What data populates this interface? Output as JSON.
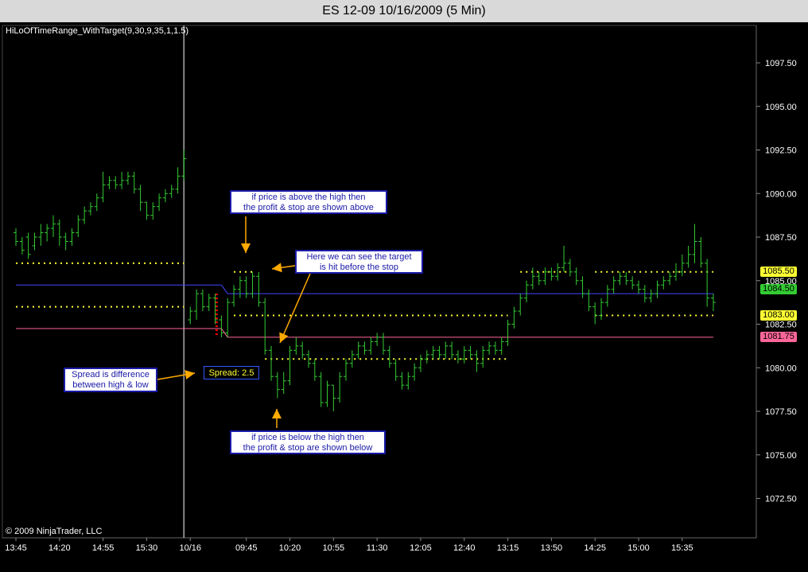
{
  "window": {
    "title": "ES 12-09  10/16/2009 (5 Min)"
  },
  "indicator_label": "HiLoOfTimeRange_WithTarget(9,30,9,35,1,1.5)",
  "copyright": "© 2009 NinjaTrader, LLC",
  "annotations": {
    "top_callout": [
      "if price is above the high then",
      "the profit & stop are shown above"
    ],
    "target_callout": [
      "Here we can see the target",
      "is hit before the stop"
    ],
    "spread_callout": [
      "Spread is difference",
      "between high & low"
    ],
    "bottom_callout": [
      "if price is below the high then",
      "the profit & stop are shown below"
    ],
    "spread_label": "Spread: 2.5"
  },
  "price_tags": [
    {
      "label": "1085.50",
      "value": 1085.5,
      "color": "#ffff33"
    },
    {
      "label": "1084.50",
      "value": 1084.5,
      "color": "#33cc33"
    },
    {
      "label": "1083.00",
      "value": 1083.0,
      "color": "#ffff33"
    },
    {
      "label": "1081.75",
      "value": 1081.75,
      "color": "#ff6699"
    }
  ],
  "colors": {
    "bars": "#33cc33",
    "target_dots": "#ffff33",
    "high_line": "#4444ff",
    "low_line": "#ff6699",
    "session_divider": "#ffffff",
    "spread_marker": "#ff0000",
    "arrow": "#ffaa00"
  },
  "chart_data": {
    "type": "ohlc",
    "title": "ES 12-09  10/16/2009 (5 Min)",
    "xlabel": "",
    "ylabel": "",
    "ylim": [
      1070.5,
      1099.5
    ],
    "y_ticks": [
      "1097.50",
      "1095.00",
      "1092.50",
      "1090.00",
      "1087.50",
      "1085.00",
      "1082.50",
      "1080.00",
      "1077.50",
      "1075.00",
      "1072.50"
    ],
    "x_ticks": [
      "13:45",
      "14:20",
      "14:55",
      "15:30",
      "10/16",
      "09:45",
      "10:20",
      "10:55",
      "11:30",
      "12:05",
      "12:40",
      "13:15",
      "13:50",
      "14:25",
      "15:00",
      "15:35"
    ],
    "x_tick_index": [
      0,
      7,
      14,
      21,
      28,
      37,
      44,
      51,
      58,
      65,
      72,
      79,
      86,
      93,
      100,
      107
    ],
    "session_break_index": 28.5,
    "bars": [
      [
        1087.75,
        1087.25
      ],
      [
        1087.25,
        1086.75
      ],
      [
        1087.5,
        1086.5
      ],
      [
        1087.0,
        1087.5
      ],
      [
        1087.5,
        1087.75
      ],
      [
        1087.75,
        1088.0
      ],
      [
        1088.0,
        1088.25
      ],
      [
        1088.25,
        1087.5
      ],
      [
        1087.5,
        1087.25
      ],
      [
        1087.25,
        1087.75
      ],
      [
        1087.75,
        1088.5
      ],
      [
        1088.5,
        1089.0
      ],
      [
        1089.0,
        1089.25
      ],
      [
        1089.25,
        1089.75
      ],
      [
        1089.75,
        1090.5
      ],
      [
        1090.5,
        1090.75
      ],
      [
        1090.75,
        1090.5
      ],
      [
        1090.5,
        1090.75
      ],
      [
        1090.75,
        1091.0
      ],
      [
        1091.0,
        1090.25
      ],
      [
        1090.25,
        1089.5
      ],
      [
        1089.5,
        1088.75
      ],
      [
        1088.75,
        1089.25
      ],
      [
        1089.25,
        1089.75
      ],
      [
        1089.75,
        1090.0
      ],
      [
        1090.0,
        1090.25
      ],
      [
        1090.25,
        1091.0
      ],
      [
        1091.0,
        1092.0
      ],
      [
        1082.75,
        1083.25
      ],
      [
        1083.25,
        1084.25
      ],
      [
        1084.25,
        1083.5
      ],
      [
        1083.5,
        1084.0
      ],
      [
        1084.0,
        1082.75
      ],
      [
        1082.75,
        1082.0
      ],
      [
        1082.0,
        1083.75
      ],
      [
        1083.75,
        1084.5
      ],
      [
        1084.5,
        1085.0
      ],
      [
        1085.0,
        1084.25
      ],
      [
        1084.25,
        1085.25
      ],
      [
        1085.25,
        1083.75
      ],
      [
        1083.75,
        1081.0
      ],
      [
        1081.0,
        1079.5
      ],
      [
        1079.5,
        1078.75
      ],
      [
        1078.75,
        1079.25
      ],
      [
        1079.25,
        1081.0
      ],
      [
        1081.0,
        1081.25
      ],
      [
        1081.25,
        1080.75
      ],
      [
        1080.75,
        1080.25
      ],
      [
        1080.25,
        1079.5
      ],
      [
        1079.5,
        1078.0
      ],
      [
        1078.0,
        1079.0
      ],
      [
        1079.0,
        1078.25
      ],
      [
        1078.25,
        1079.5
      ],
      [
        1079.5,
        1080.25
      ],
      [
        1080.25,
        1080.75
      ],
      [
        1080.75,
        1081.25
      ],
      [
        1081.25,
        1081.0
      ],
      [
        1081.0,
        1081.5
      ],
      [
        1081.5,
        1081.75
      ],
      [
        1081.75,
        1081.0
      ],
      [
        1081.0,
        1080.25
      ],
      [
        1080.25,
        1079.5
      ],
      [
        1079.5,
        1079.0
      ],
      [
        1079.0,
        1079.5
      ],
      [
        1079.5,
        1080.0
      ],
      [
        1080.0,
        1080.5
      ],
      [
        1080.5,
        1080.75
      ],
      [
        1080.75,
        1081.0
      ],
      [
        1081.0,
        1080.75
      ],
      [
        1080.75,
        1081.25
      ],
      [
        1081.25,
        1080.75
      ],
      [
        1080.75,
        1080.5
      ],
      [
        1080.5,
        1081.0
      ],
      [
        1081.0,
        1080.75
      ],
      [
        1080.75,
        1080.25
      ],
      [
        1080.25,
        1081.0
      ],
      [
        1081.0,
        1081.25
      ],
      [
        1081.25,
        1081.0
      ],
      [
        1081.0,
        1081.5
      ],
      [
        1081.5,
        1082.5
      ],
      [
        1082.5,
        1083.25
      ],
      [
        1083.25,
        1084.0
      ],
      [
        1084.0,
        1084.75
      ],
      [
        1084.75,
        1085.25
      ],
      [
        1085.25,
        1085.0
      ],
      [
        1085.0,
        1085.5
      ],
      [
        1085.5,
        1085.25
      ],
      [
        1085.25,
        1085.75
      ],
      [
        1085.75,
        1086.0
      ],
      [
        1086.0,
        1085.5
      ],
      [
        1085.5,
        1085.0
      ],
      [
        1085.0,
        1084.25
      ],
      [
        1084.25,
        1083.5
      ],
      [
        1083.5,
        1083.0
      ],
      [
        1083.0,
        1083.75
      ],
      [
        1083.75,
        1084.5
      ],
      [
        1084.5,
        1085.0
      ],
      [
        1085.0,
        1085.25
      ],
      [
        1085.25,
        1085.0
      ],
      [
        1085.0,
        1084.75
      ],
      [
        1084.75,
        1084.5
      ],
      [
        1084.5,
        1084.0
      ],
      [
        1084.0,
        1084.25
      ],
      [
        1084.25,
        1084.75
      ],
      [
        1084.75,
        1085.0
      ],
      [
        1085.0,
        1085.25
      ],
      [
        1085.25,
        1085.5
      ],
      [
        1085.5,
        1086.0
      ],
      [
        1086.0,
        1086.5
      ],
      [
        1086.5,
        1087.25
      ],
      [
        1087.25,
        1086.0
      ],
      [
        1086.0,
        1084.0
      ],
      [
        1084.0,
        1083.75
      ]
    ],
    "bar_ranges": [
      [
        1087.0,
        1088.0
      ],
      [
        1086.5,
        1087.5
      ],
      [
        1086.25,
        1087.75
      ],
      [
        1086.75,
        1087.75
      ],
      [
        1087.0,
        1088.25
      ],
      [
        1087.25,
        1088.25
      ],
      [
        1087.5,
        1088.75
      ],
      [
        1087.0,
        1088.5
      ],
      [
        1086.75,
        1087.75
      ],
      [
        1087.0,
        1088.0
      ],
      [
        1087.5,
        1088.75
      ],
      [
        1088.25,
        1089.25
      ],
      [
        1088.75,
        1089.5
      ],
      [
        1089.0,
        1090.0
      ],
      [
        1089.5,
        1091.25
      ],
      [
        1090.25,
        1091.0
      ],
      [
        1090.25,
        1091.0
      ],
      [
        1090.25,
        1091.25
      ],
      [
        1090.5,
        1091.25
      ],
      [
        1090.0,
        1091.25
      ],
      [
        1089.0,
        1090.5
      ],
      [
        1088.5,
        1089.5
      ],
      [
        1088.5,
        1089.5
      ],
      [
        1089.0,
        1090.0
      ],
      [
        1089.5,
        1090.25
      ],
      [
        1089.75,
        1090.5
      ],
      [
        1090.0,
        1091.5
      ],
      [
        1090.75,
        1092.5
      ],
      [
        1082.5,
        1083.5
      ],
      [
        1082.75,
        1084.5
      ],
      [
        1083.25,
        1084.5
      ],
      [
        1083.25,
        1084.25
      ],
      [
        1082.5,
        1084.25
      ],
      [
        1081.75,
        1083.0
      ],
      [
        1081.75,
        1084.0
      ],
      [
        1083.5,
        1084.75
      ],
      [
        1084.0,
        1085.25
      ],
      [
        1084.0,
        1085.25
      ],
      [
        1084.0,
        1085.5
      ],
      [
        1083.5,
        1085.5
      ],
      [
        1080.75,
        1084.0
      ],
      [
        1079.25,
        1081.25
      ],
      [
        1078.25,
        1079.75
      ],
      [
        1078.5,
        1079.75
      ],
      [
        1079.0,
        1081.25
      ],
      [
        1080.75,
        1081.75
      ],
      [
        1080.5,
        1081.5
      ],
      [
        1080.0,
        1081.0
      ],
      [
        1079.25,
        1080.5
      ],
      [
        1077.75,
        1079.75
      ],
      [
        1077.75,
        1079.25
      ],
      [
        1077.5,
        1079.0
      ],
      [
        1078.0,
        1079.75
      ],
      [
        1079.25,
        1080.5
      ],
      [
        1080.0,
        1081.0
      ],
      [
        1080.5,
        1081.5
      ],
      [
        1080.75,
        1081.5
      ],
      [
        1080.75,
        1081.75
      ],
      [
        1081.25,
        1082.0
      ],
      [
        1080.75,
        1082.0
      ],
      [
        1080.0,
        1081.25
      ],
      [
        1079.25,
        1080.5
      ],
      [
        1078.75,
        1079.75
      ],
      [
        1078.75,
        1079.75
      ],
      [
        1079.25,
        1080.25
      ],
      [
        1079.75,
        1080.75
      ],
      [
        1080.25,
        1081.0
      ],
      [
        1080.5,
        1081.25
      ],
      [
        1080.5,
        1081.25
      ],
      [
        1080.5,
        1081.5
      ],
      [
        1080.5,
        1081.5
      ],
      [
        1080.25,
        1081.0
      ],
      [
        1080.25,
        1081.25
      ],
      [
        1080.5,
        1081.25
      ],
      [
        1079.75,
        1081.0
      ],
      [
        1080.0,
        1081.25
      ],
      [
        1080.75,
        1081.5
      ],
      [
        1080.75,
        1081.5
      ],
      [
        1080.75,
        1081.75
      ],
      [
        1081.25,
        1082.75
      ],
      [
        1082.25,
        1083.5
      ],
      [
        1083.0,
        1084.25
      ],
      [
        1083.75,
        1085.0
      ],
      [
        1084.5,
        1085.75
      ],
      [
        1084.75,
        1085.5
      ],
      [
        1084.75,
        1085.75
      ],
      [
        1085.0,
        1085.75
      ],
      [
        1085.0,
        1086.0
      ],
      [
        1085.5,
        1087.0
      ],
      [
        1085.25,
        1086.25
      ],
      [
        1084.75,
        1085.75
      ],
      [
        1084.0,
        1085.25
      ],
      [
        1083.25,
        1084.5
      ],
      [
        1082.5,
        1083.75
      ],
      [
        1082.75,
        1084.0
      ],
      [
        1083.5,
        1084.75
      ],
      [
        1084.25,
        1085.25
      ],
      [
        1084.75,
        1085.5
      ],
      [
        1084.75,
        1085.5
      ],
      [
        1084.5,
        1085.25
      ],
      [
        1084.25,
        1085.0
      ],
      [
        1083.75,
        1084.75
      ],
      [
        1083.75,
        1084.5
      ],
      [
        1084.0,
        1085.0
      ],
      [
        1084.5,
        1085.25
      ],
      [
        1084.75,
        1085.5
      ],
      [
        1085.0,
        1086.0
      ],
      [
        1085.25,
        1086.5
      ],
      [
        1085.75,
        1087.0
      ],
      [
        1086.0,
        1088.25
      ],
      [
        1085.75,
        1087.5
      ],
      [
        1083.5,
        1086.25
      ],
      [
        1083.25,
        1084.25
      ]
    ],
    "levels": [
      {
        "name": "prev_target_high",
        "value": 1086.0,
        "from": 0,
        "to": 27,
        "style": "dotted",
        "color": "#ffff33"
      },
      {
        "name": "prev_high",
        "value": 1084.75,
        "from": 0,
        "to": 33,
        "style": "solid",
        "color": "#4444ff"
      },
      {
        "name": "prev_target_low",
        "value": 1083.5,
        "from": 0,
        "to": 27,
        "style": "dotted",
        "color": "#ffff33"
      },
      {
        "name": "prev_low",
        "value": 1082.25,
        "from": 0,
        "to": 33,
        "style": "solid",
        "color": "#ff6699"
      },
      {
        "name": "high",
        "value": 1084.25,
        "from": 34,
        "to": 112,
        "style": "solid",
        "color": "#4444ff"
      },
      {
        "name": "low",
        "value": 1081.75,
        "from": 34,
        "to": 112,
        "style": "solid",
        "color": "#ff6699"
      },
      {
        "name": "target_up_1",
        "value": 1085.5,
        "from": 35,
        "to": 38,
        "style": "dotted",
        "color": "#ffff33"
      },
      {
        "name": "stop_up_1",
        "value": 1083.0,
        "from": 35,
        "to": 79,
        "style": "dotted",
        "color": "#ffff33"
      },
      {
        "name": "target_down_1",
        "value": 1080.5,
        "from": 40,
        "to": 79,
        "style": "dotted",
        "color": "#ffff33"
      },
      {
        "name": "target_up_2",
        "value": 1085.5,
        "from": 81,
        "to": 89,
        "style": "dotted",
        "color": "#ffff33"
      },
      {
        "name": "target_up_3",
        "value": 1085.5,
        "from": 93,
        "to": 112,
        "style": "dotted",
        "color": "#ffff33"
      },
      {
        "name": "stop_up_2",
        "value": 1083.0,
        "from": 93,
        "to": 112,
        "style": "dotted",
        "color": "#ffff33"
      }
    ]
  }
}
